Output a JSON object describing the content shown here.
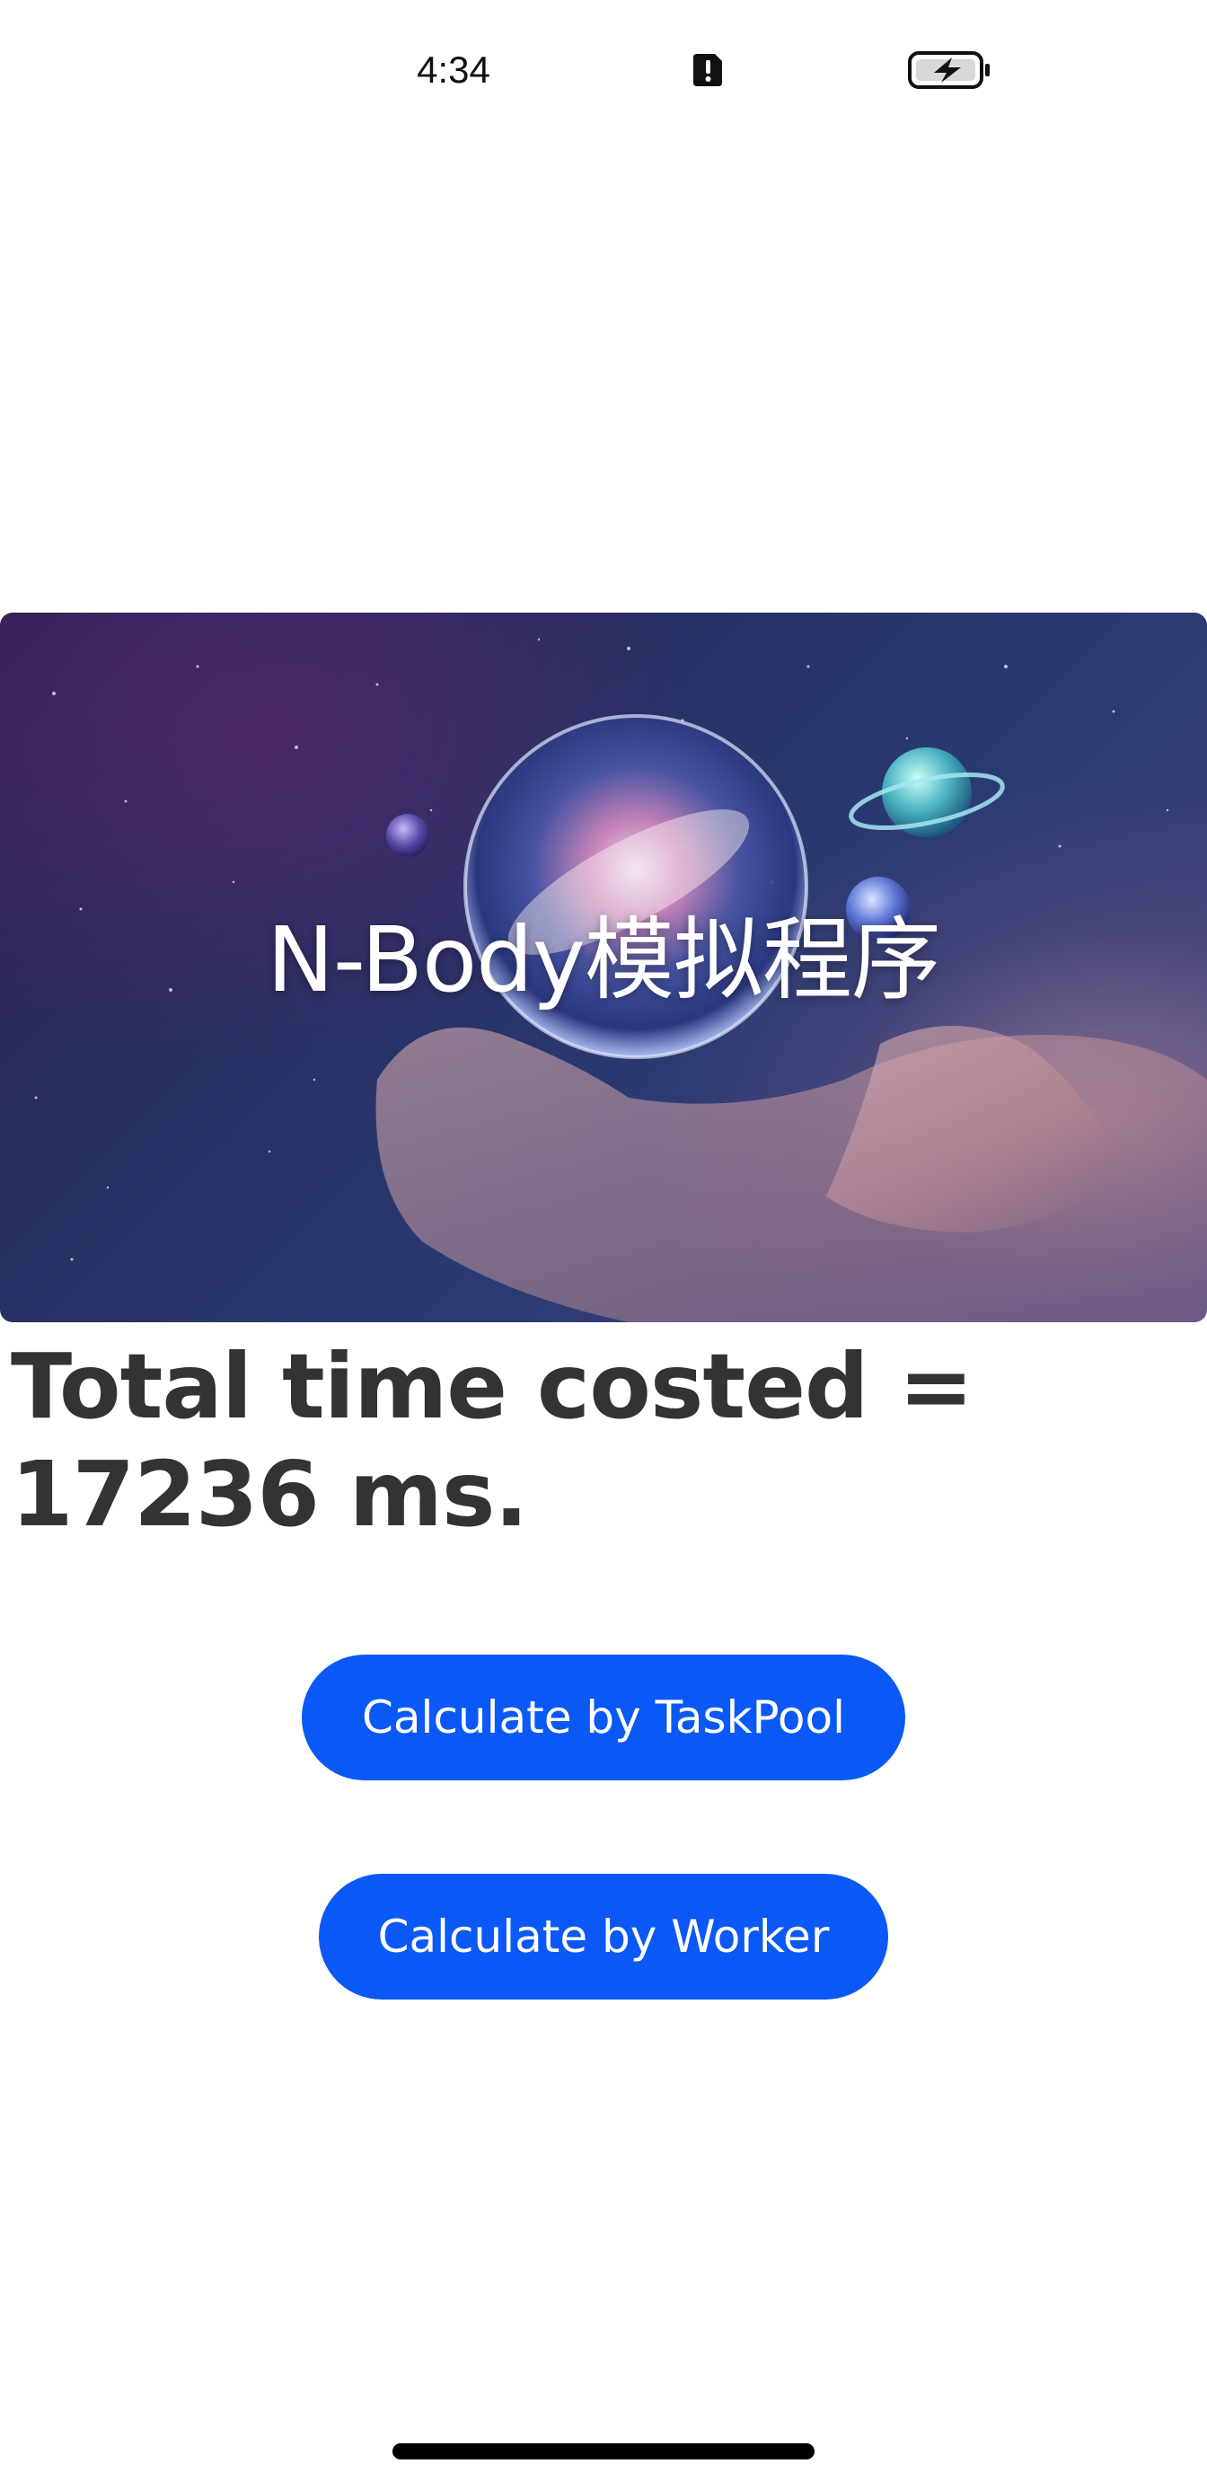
{
  "status_bar": {
    "time": "4:34",
    "alert_icon": "alert-icon",
    "battery_icon": "battery-charging-icon"
  },
  "banner": {
    "title": "N-Body模拟程序",
    "image": "galaxy-in-hands-image"
  },
  "result": {
    "text": "Total time costed = 17236 ms."
  },
  "buttons": {
    "taskpool_label": "Calculate by TaskPool",
    "worker_label": "Calculate by Worker"
  },
  "colors": {
    "button_background": "#0a59f7",
    "button_text": "#ffffff",
    "result_text": "#333333"
  }
}
